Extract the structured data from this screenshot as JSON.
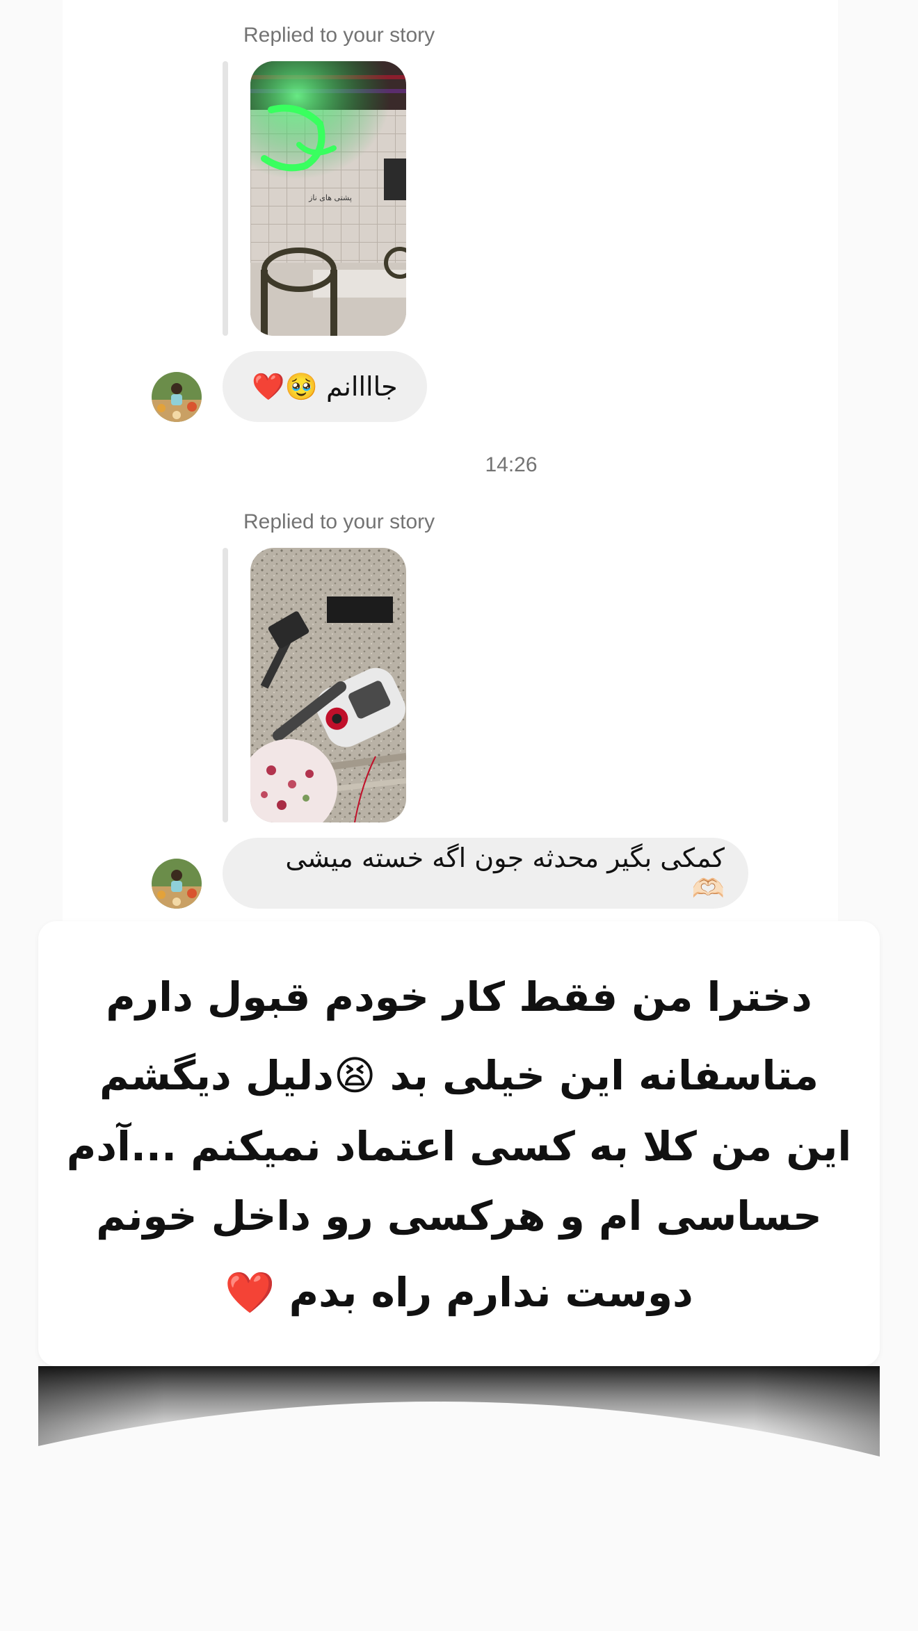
{
  "chat": {
    "messages": [
      {
        "replied_label": "Replied to your story",
        "story_thumb_icon": "neon-cafe-story-image",
        "story_caption": "پشتی های ناز",
        "reply_text": "جاااانم 🥹❤️"
      },
      {
        "replied_label": "Replied to your story",
        "story_thumb_icon": "vacuum-cleaner-story-image",
        "reply_text": "کمکی بگیر محدثه جون اگه خسته میشی 🫶🏻"
      }
    ],
    "timestamp": "14:26"
  },
  "overlay": {
    "lines": [
      "دخترا من فقط کار خودم قبول دارم",
      "متاسفانه این خیلی بد 😫دلیل دیگشم",
      "این من کلا به کسی اعتماد نمیکنم ...آدم",
      "حساسی ام و هرکسی رو داخل خونم",
      "دوست ندارم راه بدم ❤️"
    ]
  },
  "colors": {
    "bubble_bg": "#efefef",
    "meta_text": "#737373",
    "reply_bar": "#e4e4e4",
    "neon_green": "#2bff5a"
  }
}
